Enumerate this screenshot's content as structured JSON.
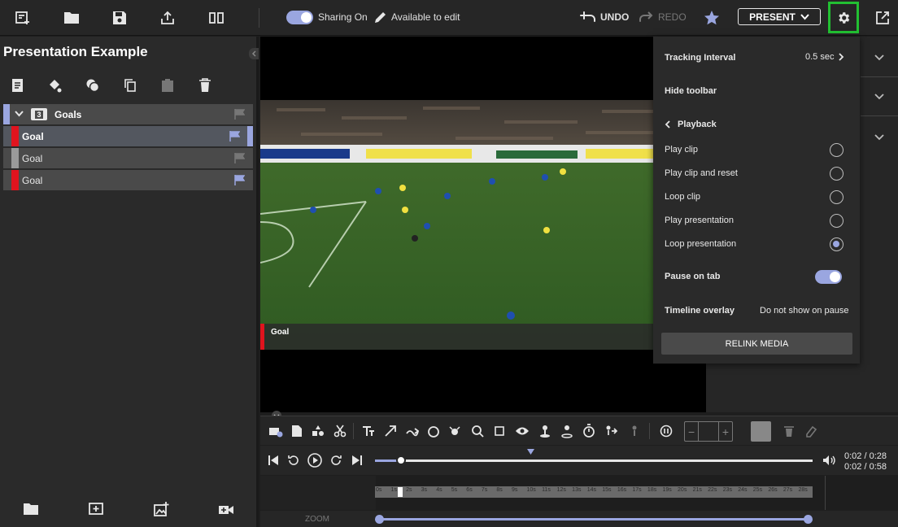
{
  "toolbar": {
    "sharing_label": "Sharing On",
    "available_label": "Available to edit",
    "undo_label": "UNDO",
    "redo_label": "REDO",
    "present_label": "PRESENT"
  },
  "sidebar": {
    "title": "Presentation Example",
    "group": {
      "count": "3",
      "label": "Goals"
    },
    "clips": [
      {
        "label": "Goal",
        "bold": true
      },
      {
        "label": "Goal",
        "bold": false
      },
      {
        "label": "Goal",
        "bold": false
      }
    ]
  },
  "video": {
    "caption": "Goal"
  },
  "settings": {
    "tracking_label": "Tracking Interval",
    "tracking_value": "0.5 sec",
    "hide_toolbar_label": "Hide toolbar",
    "playback_label": "Playback",
    "options": [
      {
        "label": "Play clip",
        "selected": false
      },
      {
        "label": "Play clip and reset",
        "selected": false
      },
      {
        "label": "Loop clip",
        "selected": false
      },
      {
        "label": "Play presentation",
        "selected": false
      },
      {
        "label": "Loop presentation",
        "selected": true
      }
    ],
    "pause_label": "Pause on tab",
    "pause_enabled": true,
    "overlay_label": "Timeline overlay",
    "overlay_value": "Do not show on pause",
    "relink_label": "RELINK MEDIA"
  },
  "player": {
    "time_current": "0:02 / 0:28",
    "time_total": "0:02 / 0:58",
    "progress": 0.06
  },
  "timeline": {
    "ticks": [
      "0s",
      "1s",
      "2s",
      "3s",
      "4s",
      "5s",
      "6s",
      "7s",
      "8s",
      "9s",
      "10s",
      "11s",
      "12s",
      "13s",
      "14s",
      "15s",
      "16s",
      "17s",
      "18s",
      "19s",
      "20s",
      "21s",
      "22s",
      "23s",
      "24s",
      "25s",
      "26s",
      "27s",
      "28s"
    ],
    "zoom_label": "ZOOM"
  },
  "colors": {
    "accent": "#9aa6e0",
    "highlight_green": "#22c032",
    "clip_red": "#e0141e"
  }
}
